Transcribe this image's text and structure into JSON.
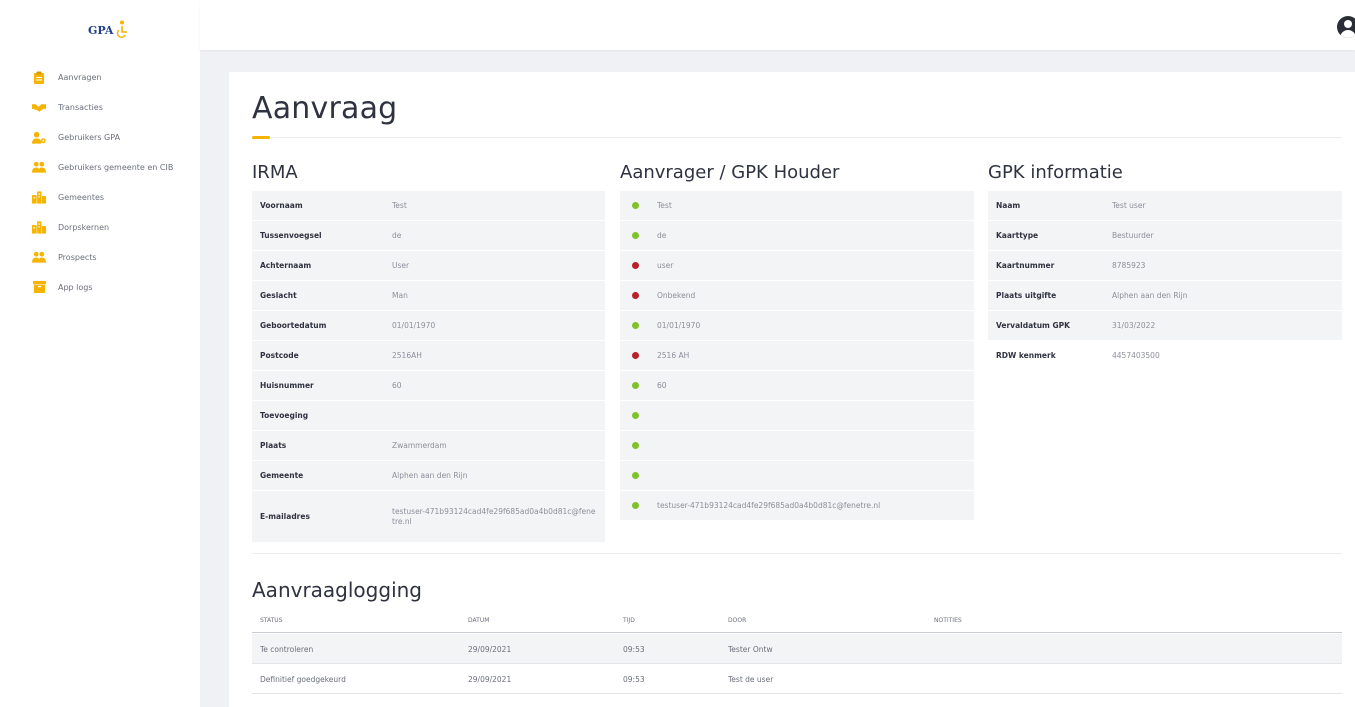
{
  "sidebar": {
    "logo_text": "GPA",
    "items": [
      {
        "label": "Aanvragen",
        "icon": "clipboard-icon"
      },
      {
        "label": "Transacties",
        "icon": "handshake-icon"
      },
      {
        "label": "Gebruikers GPA",
        "icon": "user-gear-icon"
      },
      {
        "label": "Gebruikers gemeente en CIB",
        "icon": "users-icon"
      },
      {
        "label": "Gemeentes",
        "icon": "city-icon"
      },
      {
        "label": "Dorpskernen",
        "icon": "city-icon"
      },
      {
        "label": "Prospects",
        "icon": "users-icon"
      },
      {
        "label": "App logs",
        "icon": "archive-icon"
      }
    ]
  },
  "colors": {
    "accent": "#f4b400",
    "ok": "#7ec22c",
    "error": "#b7222a",
    "heading": "#2f3240"
  },
  "page": {
    "title": "Aanvraag"
  },
  "irma": {
    "title": "IRMA",
    "rows": [
      {
        "key": "Voornaam",
        "value": "Test"
      },
      {
        "key": "Tussenvoegsel",
        "value": "de"
      },
      {
        "key": "Achternaam",
        "value": "User"
      },
      {
        "key": "Geslacht",
        "value": "Man"
      },
      {
        "key": "Geboortedatum",
        "value": "01/01/1970"
      },
      {
        "key": "Postcode",
        "value": "2516AH"
      },
      {
        "key": "Huisnummer",
        "value": "60"
      },
      {
        "key": "Toevoeging",
        "value": ""
      },
      {
        "key": "Plaats",
        "value": "Zwammerdam"
      },
      {
        "key": "Gemeente",
        "value": "Alphen aan den Rijn"
      },
      {
        "key": "E-mailadres",
        "value": "testuser-471b93124cad4fe29f685ad0a4b0d81c@fenetre.nl"
      }
    ]
  },
  "aanvrager": {
    "title": "Aanvrager / GPK Houder",
    "rows": [
      {
        "status": "ok",
        "value": "Test"
      },
      {
        "status": "ok",
        "value": "de"
      },
      {
        "status": "error",
        "value": "user"
      },
      {
        "status": "error",
        "value": "Onbekend"
      },
      {
        "status": "ok",
        "value": "01/01/1970"
      },
      {
        "status": "error",
        "value": "2516 AH"
      },
      {
        "status": "ok",
        "value": "60"
      },
      {
        "status": "ok",
        "value": ""
      },
      {
        "status": "ok",
        "value": ""
      },
      {
        "status": "ok",
        "value": ""
      },
      {
        "status": "ok",
        "value": "testuser-471b93124cad4fe29f685ad0a4b0d81c@fenetre.nl"
      }
    ]
  },
  "gpk": {
    "title": "GPK informatie",
    "rows": [
      {
        "key": "Naam",
        "value": "Test user"
      },
      {
        "key": "Kaarttype",
        "value": "Bestuurder"
      },
      {
        "key": "Kaartnummer",
        "value": "8785923"
      },
      {
        "key": "Plaats uitgifte",
        "value": "Alphen aan den Rijn"
      },
      {
        "key": "Vervaldatum GPK",
        "value": "31/03/2022"
      },
      {
        "key": "RDW kenmerk",
        "value": "4457403500"
      }
    ]
  },
  "logging": {
    "title": "Aanvraaglogging",
    "columns": [
      "STATUS",
      "DATUM",
      "TIJD",
      "DOOR",
      "NOTITIES"
    ],
    "rows": [
      {
        "status": "Te controleren",
        "datum": "29/09/2021",
        "tijd": "09:53",
        "door": "Tester Ontw",
        "notities": ""
      },
      {
        "status": "Definitief goedgekeurd",
        "datum": "29/09/2021",
        "tijd": "09:53",
        "door": "Test de user",
        "notities": ""
      }
    ]
  }
}
